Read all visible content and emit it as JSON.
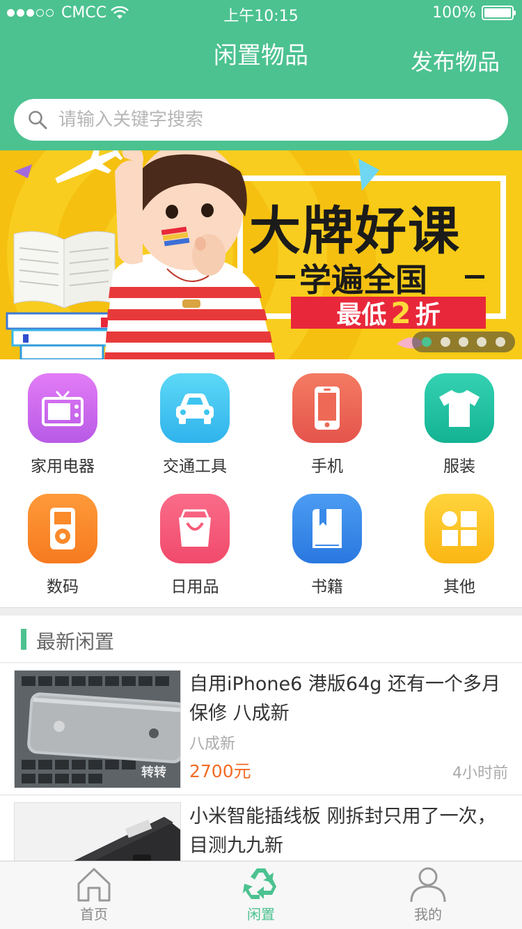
{
  "status_bar": {
    "carrier": "CMCC",
    "time": "上午10:15",
    "battery": "100%"
  },
  "nav": {
    "title": "闲置物品",
    "publish": "发布物品"
  },
  "search": {
    "placeholder": "请输入关键字搜索"
  },
  "banner": {
    "title": "大牌好课",
    "subtitle": "学遍全国",
    "ribbon_prefix": "最低",
    "ribbon_number": "2",
    "ribbon_suffix": "折",
    "page_count": 5,
    "active_page": 1
  },
  "categories": [
    {
      "label": "家用电器",
      "icon": "tv-icon",
      "color": "#c86df0"
    },
    {
      "label": "交通工具",
      "icon": "car-icon",
      "color": "#3ec5f0"
    },
    {
      "label": "手机",
      "icon": "phone-icon",
      "color": "#ee6a56"
    },
    {
      "label": "服装",
      "icon": "shirt-icon",
      "color": "#27c4a5"
    },
    {
      "label": "数码",
      "icon": "ipod-icon",
      "color": "#fb8a2b"
    },
    {
      "label": "日用品",
      "icon": "shopping-bag-icon",
      "color": "#f65b79"
    },
    {
      "label": "书籍",
      "icon": "book-icon",
      "color": "#3889ea"
    },
    {
      "label": "其他",
      "icon": "grid-icon",
      "color": "#fbc524"
    }
  ],
  "latest": {
    "title": "最新闲置",
    "items": [
      {
        "title": "自用iPhone6 港版64g 还有一个多月保修 八成新",
        "condition": "八成新",
        "price": "2700元",
        "time": "4小时前",
        "watermark": "转转"
      },
      {
        "title": "小米智能插线板 刚拆封只用了一次，目测九九新",
        "condition": "",
        "price": "",
        "time": ""
      }
    ]
  },
  "tabbar": {
    "tabs": [
      {
        "label": "首页",
        "icon": "home-icon"
      },
      {
        "label": "闲置",
        "icon": "recycle-icon"
      },
      {
        "label": "我的",
        "icon": "user-icon"
      }
    ],
    "active": 1
  },
  "colors": {
    "primary": "#4cc290",
    "price": "#f26b24",
    "banner_bg": "#f7cb17"
  }
}
